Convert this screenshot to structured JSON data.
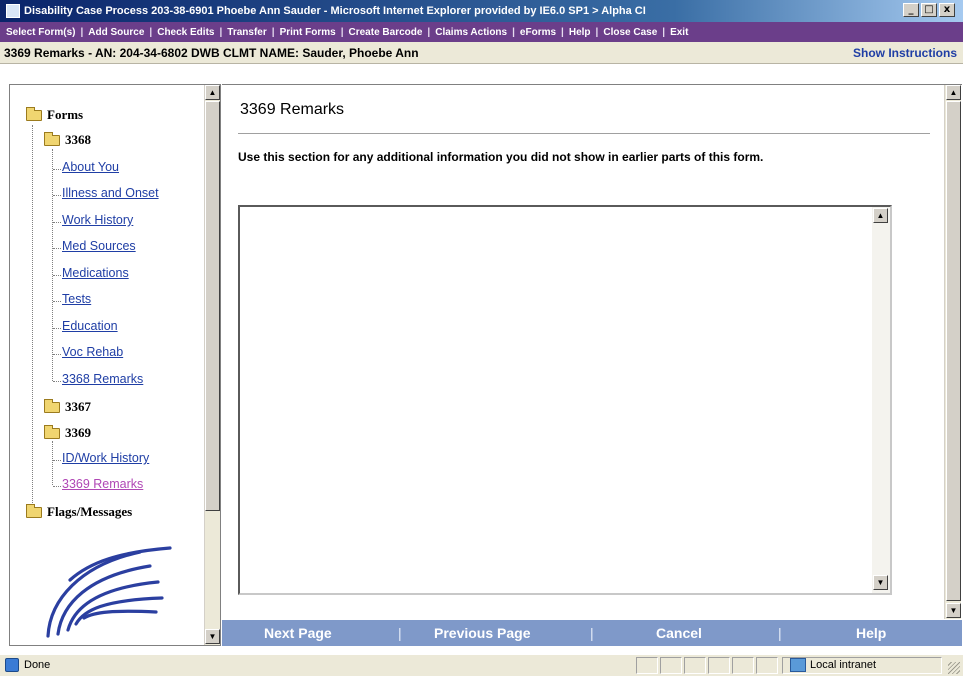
{
  "window": {
    "title": "Disability Case Process 203-38-6901 Phoebe Ann Sauder - Microsoft Internet Explorer provided by IE6.0 SP1 > Alpha CI",
    "buttons": {
      "minimize": "_",
      "maximize": "□",
      "close": "x"
    }
  },
  "menu": {
    "items": [
      "Select Form(s)",
      "Add Source",
      "Check Edits",
      "Transfer",
      "Print Forms",
      "Create Barcode",
      "Claims Actions",
      "eForms",
      "Help",
      "Close Case",
      "Exit"
    ],
    "separator": "|"
  },
  "header": {
    "text": "3369 Remarks - AN: 204-34-6802 DWB CLMT NAME: Sauder, Phoebe Ann",
    "show_instructions": "Show Instructions"
  },
  "tree": {
    "forms": "Forms",
    "f3368": "3368",
    "f3368_items": [
      "About You",
      "Illness and Onset",
      "Work History",
      "Med Sources",
      "Medications",
      "Tests",
      "Education",
      "Voc Rehab",
      "3368 Remarks"
    ],
    "f3367": "3367",
    "f3369": "3369",
    "f3369_items": [
      "ID/Work History",
      "3369 Remarks"
    ],
    "flags": "Flags/Messages"
  },
  "content": {
    "title": "3369 Remarks",
    "instruction": "Use this section for any additional information you did not show in earlier parts of this form.",
    "remarks_value": ""
  },
  "nav": {
    "next": "Next Page",
    "previous": "Previous Page",
    "cancel": "Cancel",
    "help": "Help",
    "separator": "|"
  },
  "status": {
    "done": "Done",
    "zone": "Local intranet"
  },
  "colors": {
    "menubar": "#6b3e8a",
    "link": "#1f3ea5",
    "visited_link": "#b047b5",
    "nav_bar": "#7f99c9"
  }
}
